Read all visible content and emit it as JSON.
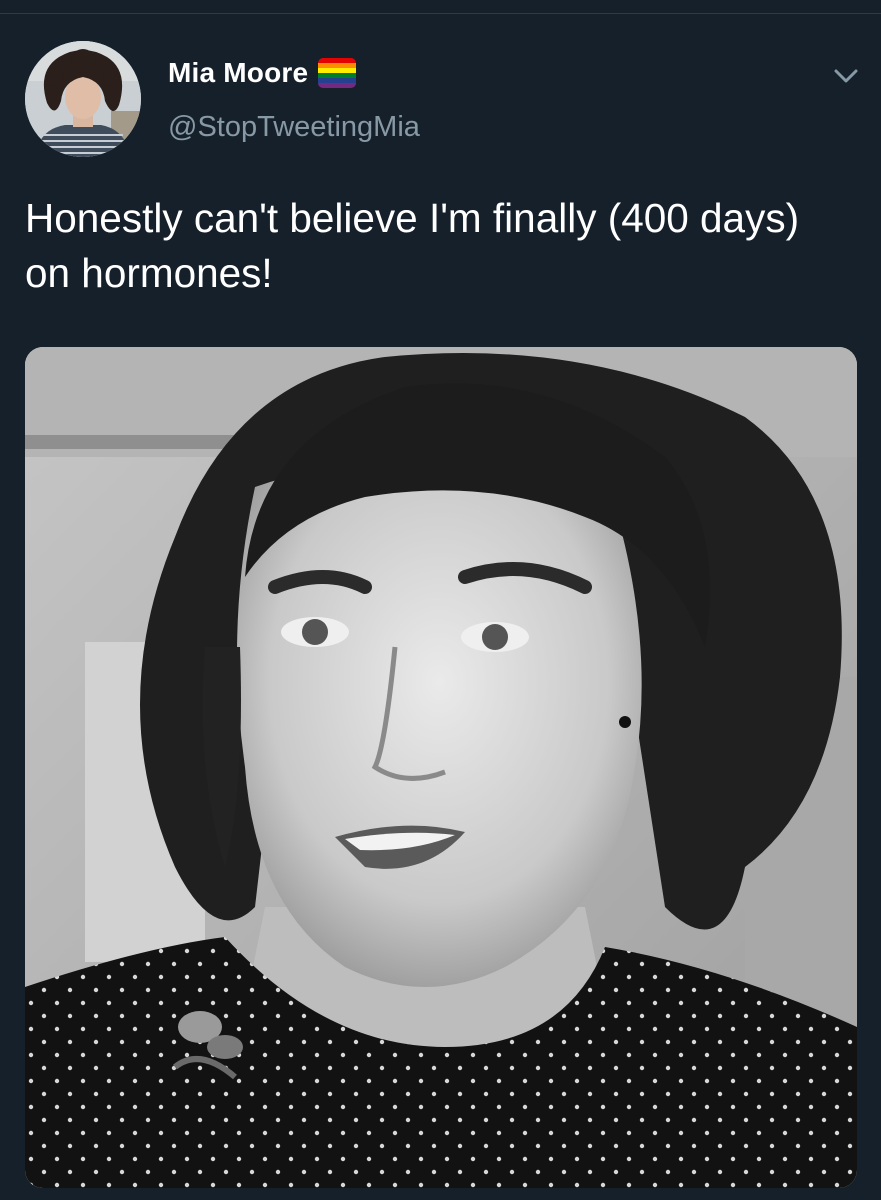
{
  "tweet": {
    "author": {
      "display_name": "Mia Moore",
      "handle": "@StopTweetingMia",
      "badge_icon": "rainbow-pride-flag-icon",
      "flag_colors": [
        "#e40303",
        "#ff8c00",
        "#ffed00",
        "#008026",
        "#24408e",
        "#732982"
      ]
    },
    "text": "Honestly can't believe I'm finally (400 days) on hormones!",
    "menu_icon": "chevron-down-icon",
    "media": {
      "kind": "photo",
      "style": "black-and-white portrait"
    }
  },
  "colors": {
    "background": "#15202b",
    "primary_text": "#ffffff",
    "secondary_text": "#8899a6"
  }
}
